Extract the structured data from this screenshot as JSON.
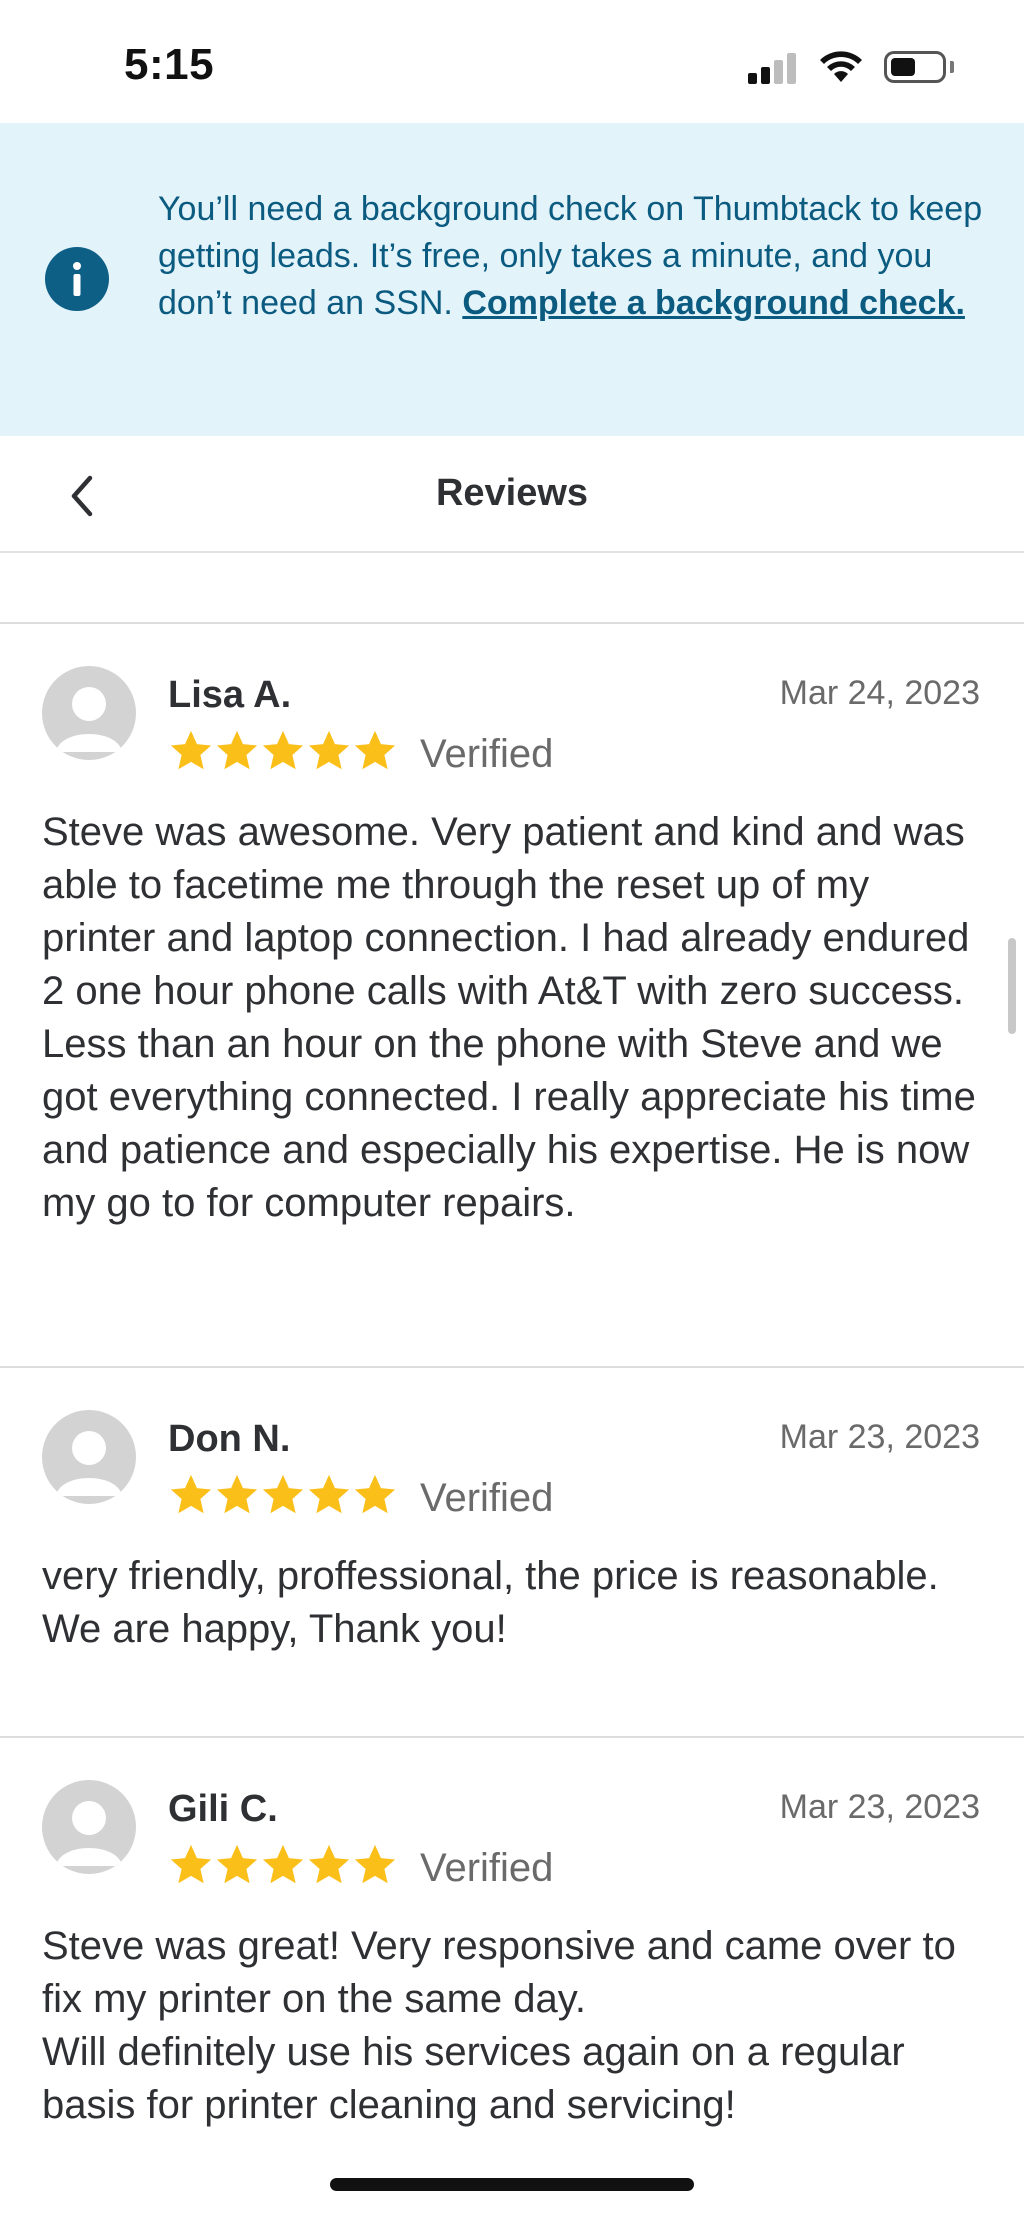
{
  "status_bar": {
    "time": "5:15",
    "signal_icon": "cellular-signal-icon",
    "wifi_icon": "wifi-icon",
    "battery_icon": "battery-icon"
  },
  "banner": {
    "icon": "info-icon",
    "message": "You’ll need a background check on Thumbtack to keep getting leads. It’s free, only takes a minute, and you don’t need an SSN.",
    "link_text": "Complete a background check.",
    "background_color": "#e3f3fa",
    "text_color": "#0b5a80"
  },
  "header": {
    "back_icon": "chevron-left-icon",
    "title": "Reviews"
  },
  "reviews": [
    {
      "name": "Lisa A.",
      "date": "Mar 24, 2023",
      "rating": 5,
      "verified_label": "Verified",
      "text": "Steve was awesome. Very patient and kind and was able to facetime me through the reset up of my printer and laptop connection. I had already endured 2 one hour phone calls with At&T with zero success.  Less than an hour on the phone with Steve and we got everything connected.   I really appreciate his time and patience and especially his expertise. He is now my go to for computer repairs."
    },
    {
      "name": "Don N.",
      "date": "Mar 23, 2023",
      "rating": 5,
      "verified_label": "Verified",
      "text": "very friendly, proffessional, the price is reasonable. We are happy, Thank you!"
    },
    {
      "name": "Gili C.",
      "date": "Mar 23, 2023",
      "rating": 5,
      "verified_label": "Verified",
      "text": "Steve was great! Very responsive and came over to fix my printer on the same day.\nWill definitely use his services again on a regular basis for printer cleaning and servicing!"
    }
  ],
  "colors": {
    "star": "#fbbf1a",
    "accent": "#0d5f86"
  }
}
